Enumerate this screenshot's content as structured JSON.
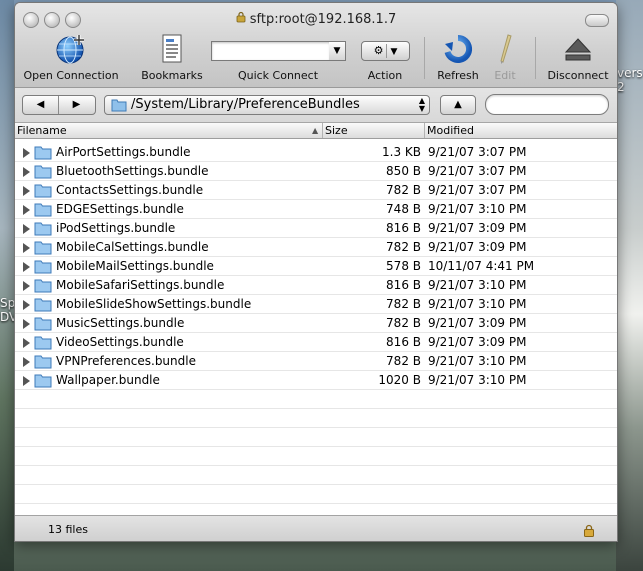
{
  "window": {
    "title": "sftp:root@192.168.1.7"
  },
  "toolbar": {
    "open_connection": "Open Connection",
    "bookmarks": "Bookmarks",
    "quick_connect": "Quick Connect",
    "quick_connect_value": "",
    "action": "Action",
    "refresh": "Refresh",
    "edit": "Edit",
    "disconnect": "Disconnect"
  },
  "navigation": {
    "back": "◀",
    "forward": "▶",
    "path": "/System/Library/PreferenceBundles",
    "up": "▲",
    "search_value": ""
  },
  "columns": {
    "filename": "Filename",
    "size": "Size",
    "modified": "Modified"
  },
  "files": [
    {
      "name": "AirPortSettings.bundle",
      "size": "1.3 KB",
      "modified": "9/21/07 3:07 PM"
    },
    {
      "name": "BluetoothSettings.bundle",
      "size": "850 B",
      "modified": "9/21/07 3:07 PM"
    },
    {
      "name": "ContactsSettings.bundle",
      "size": "782 B",
      "modified": "9/21/07 3:07 PM"
    },
    {
      "name": "EDGESettings.bundle",
      "size": "748 B",
      "modified": "9/21/07 3:10 PM"
    },
    {
      "name": "iPodSettings.bundle",
      "size": "816 B",
      "modified": "9/21/07 3:09 PM"
    },
    {
      "name": "MobileCalSettings.bundle",
      "size": "782 B",
      "modified": "9/21/07 3:09 PM"
    },
    {
      "name": "MobileMailSettings.bundle",
      "size": "578 B",
      "modified": "10/11/07 4:41 PM"
    },
    {
      "name": "MobileSafariSettings.bundle",
      "size": "816 B",
      "modified": "9/21/07 3:10 PM"
    },
    {
      "name": "MobileSlideShowSettings.bundle",
      "size": "782 B",
      "modified": "9/21/07 3:10 PM"
    },
    {
      "name": "MusicSettings.bundle",
      "size": "782 B",
      "modified": "9/21/07 3:09 PM"
    },
    {
      "name": "VideoSettings.bundle",
      "size": "816 B",
      "modified": "9/21/07 3:09 PM"
    },
    {
      "name": "VPNPreferences.bundle",
      "size": "782 B",
      "modified": "9/21/07 3:10 PM"
    },
    {
      "name": "Wallpaper.bundle",
      "size": "1020 B",
      "modified": "9/21/07 3:10 PM"
    }
  ],
  "status": {
    "count": "13 files"
  },
  "desktop": {
    "left_frag_1": "Sp",
    "left_frag_2": "DV",
    "right_frag_1": "vers",
    "right_frag_2": "2"
  }
}
